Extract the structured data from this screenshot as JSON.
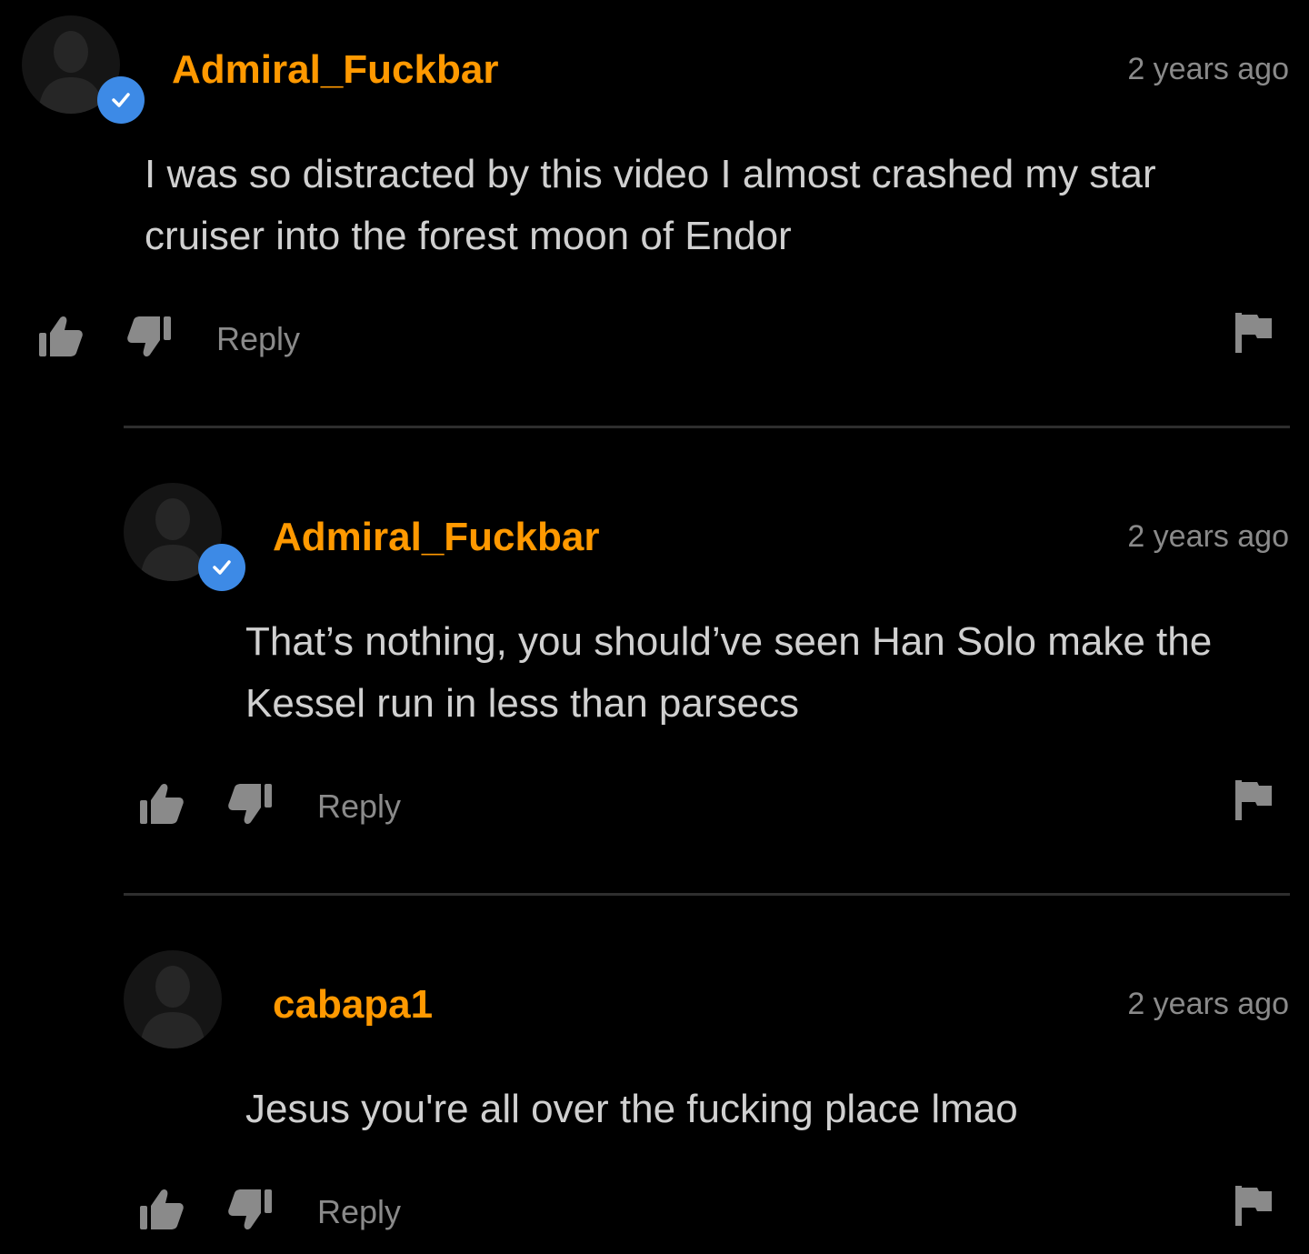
{
  "comments": [
    {
      "username": "Admiral_Fuckbar",
      "verified": true,
      "timestamp": "2 years ago",
      "text_lines": [
        "I was so distracted by this video I almost crashed my star",
        "cruiser into the forest moon of Endor"
      ],
      "reply_label": "Reply"
    },
    {
      "username": "Admiral_Fuckbar",
      "verified": true,
      "timestamp": "2 years ago",
      "text_lines": [
        "That’s nothing, you should’ve seen Han Solo make the",
        "Kessel run in less than parsecs"
      ],
      "reply_label": "Reply"
    },
    {
      "username": "cabapa1",
      "verified": false,
      "timestamp": "2 years ago",
      "text_lines": [
        "Jesus you're all over the fucking place lmao"
      ],
      "reply_label": "Reply"
    }
  ],
  "icons": {
    "avatar": "user-silhouette-icon",
    "verified": "verified-check-icon",
    "like": "thumbs-up-icon",
    "dislike": "thumbs-down-icon",
    "report": "flag-icon"
  },
  "colors": {
    "background": "#000000",
    "username": "#ff9900",
    "verified_badge": "#3d8ae6",
    "text": "#d0d0d0",
    "muted": "#8a8a8a",
    "divider": "#2e2e2e"
  }
}
